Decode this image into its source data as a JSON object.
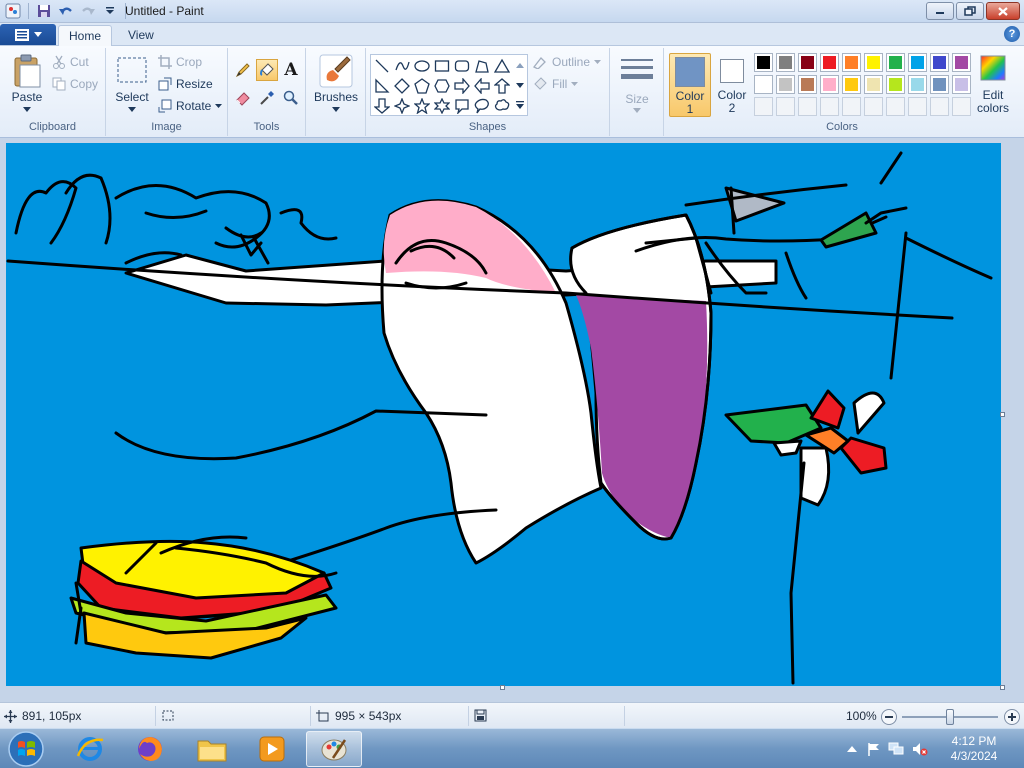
{
  "window": {
    "title": "Untitled - Paint"
  },
  "tabs": [
    {
      "label": "Home"
    },
    {
      "label": "View"
    }
  ],
  "help": "?",
  "clipboard": {
    "paste": "Paste",
    "cut": "Cut",
    "copy": "Copy",
    "label": "Clipboard"
  },
  "image": {
    "select": "Select",
    "crop": "Crop",
    "resize": "Resize",
    "rotate": "Rotate",
    "label": "Image"
  },
  "tools": {
    "label": "Tools",
    "text_tool": "A"
  },
  "brushes": {
    "label": "Brushes"
  },
  "shapes": {
    "outline": "Outline",
    "fill": "Fill",
    "label": "Shapes"
  },
  "size": {
    "label": "Size"
  },
  "colors": {
    "color1_label": "Color",
    "color1_num": "1",
    "color2_label": "Color",
    "color2_num": "2",
    "edit_label": "Edit",
    "edit_label2": "colors",
    "label": "Colors",
    "color1": "#7094c4",
    "color2": "#ffffff",
    "palette_row1": [
      "#000000",
      "#7f7f7f",
      "#880015",
      "#ed1c24",
      "#ff7f27",
      "#fff200",
      "#22b14c",
      "#00a2e8",
      "#3f48cc",
      "#a349a4"
    ],
    "palette_row2": [
      "#ffffff",
      "#c3c3c3",
      "#b97a57",
      "#ffaec9",
      "#ffc90e",
      "#efe4b0",
      "#b5e61d",
      "#99d9ea",
      "#7092be",
      "#c8bfe7"
    ]
  },
  "canvas": {
    "background": "#0094df"
  },
  "status": {
    "cursor_pos": "891, 105px",
    "canvas_size": "995 × 543px",
    "zoom": "100%"
  },
  "taskbar": {
    "time": "4:12 PM",
    "date": "4/3/2024"
  }
}
